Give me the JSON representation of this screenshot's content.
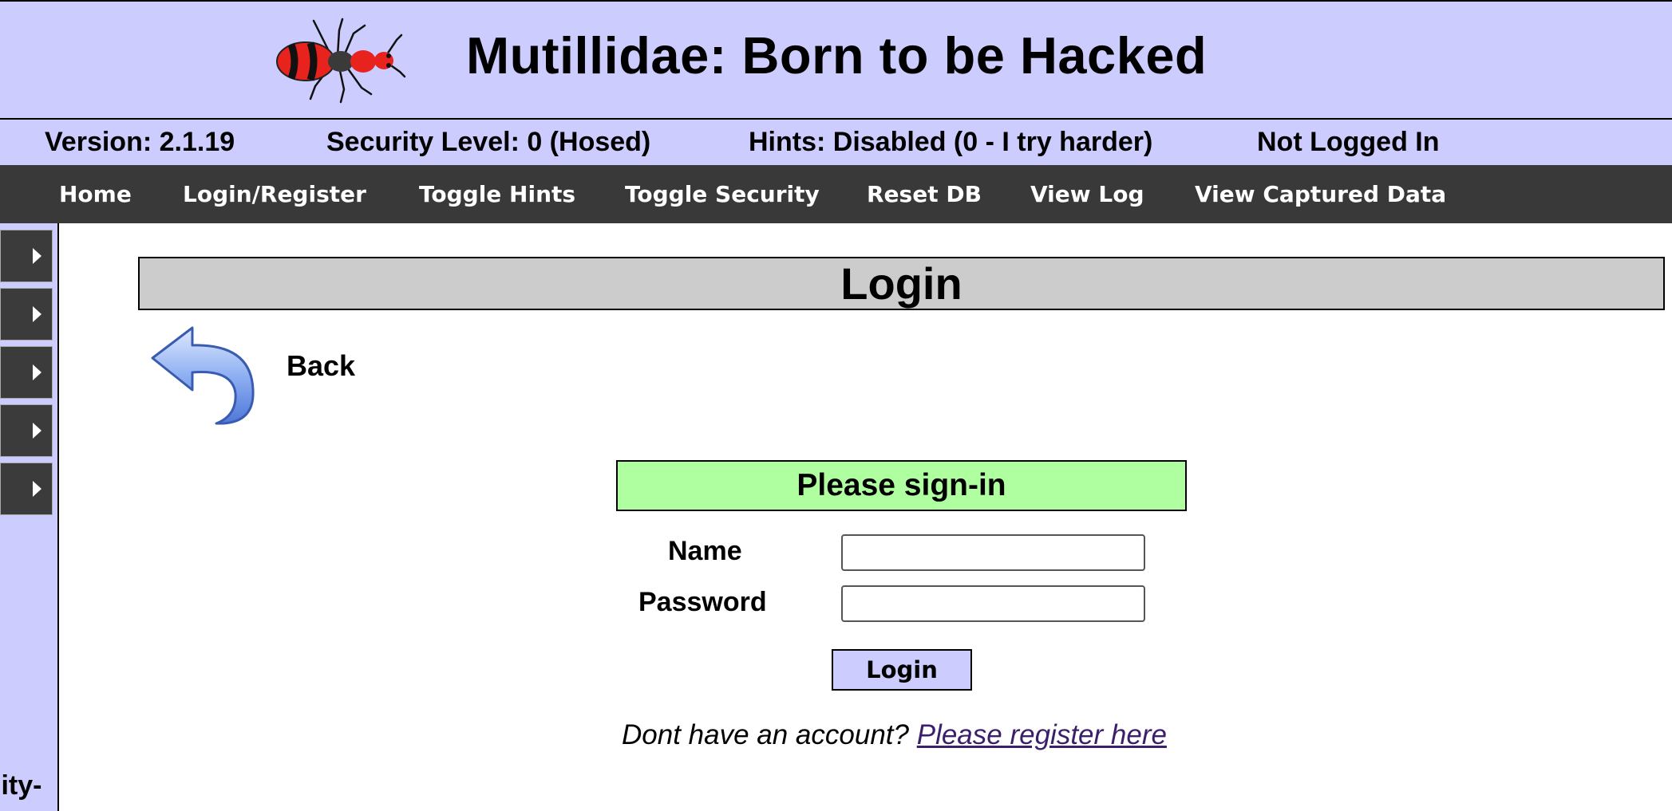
{
  "header": {
    "title": "Mutillidae: Born to be Hacked",
    "logo_icon": "ant-logo-icon"
  },
  "status": {
    "version": "Version: 2.1.19",
    "security_level": "Security Level: 0 (Hosed)",
    "hints": "Hints: Disabled (0 - I try harder)",
    "login_state": "Not Logged In"
  },
  "nav": {
    "items": [
      {
        "label": "Home"
      },
      {
        "label": "Login/Register"
      },
      {
        "label": "Toggle Hints"
      },
      {
        "label": "Toggle Security"
      },
      {
        "label": "Reset DB"
      },
      {
        "label": "View Log"
      },
      {
        "label": "View Captured Data"
      }
    ]
  },
  "sidebar": {
    "expand_icon": "triangle-right-icon",
    "text_fragment": "lity-"
  },
  "main": {
    "page_title": "Login",
    "back": {
      "icon": "back-arrow-icon",
      "label": "Back"
    },
    "form": {
      "heading": "Please sign-in",
      "name_label": "Name",
      "name_value": "",
      "password_label": "Password",
      "password_value": "",
      "submit_label": "Login"
    },
    "register": {
      "prompt": "Dont have an account?",
      "link_label": "Please register here"
    }
  },
  "colors": {
    "header_bg": "#ccccff",
    "nav_bg": "#393939",
    "title_bar_bg": "#cccccc",
    "signin_bg": "#afffa0",
    "button_bg": "#ccccff",
    "link": "#3b1f6b"
  }
}
